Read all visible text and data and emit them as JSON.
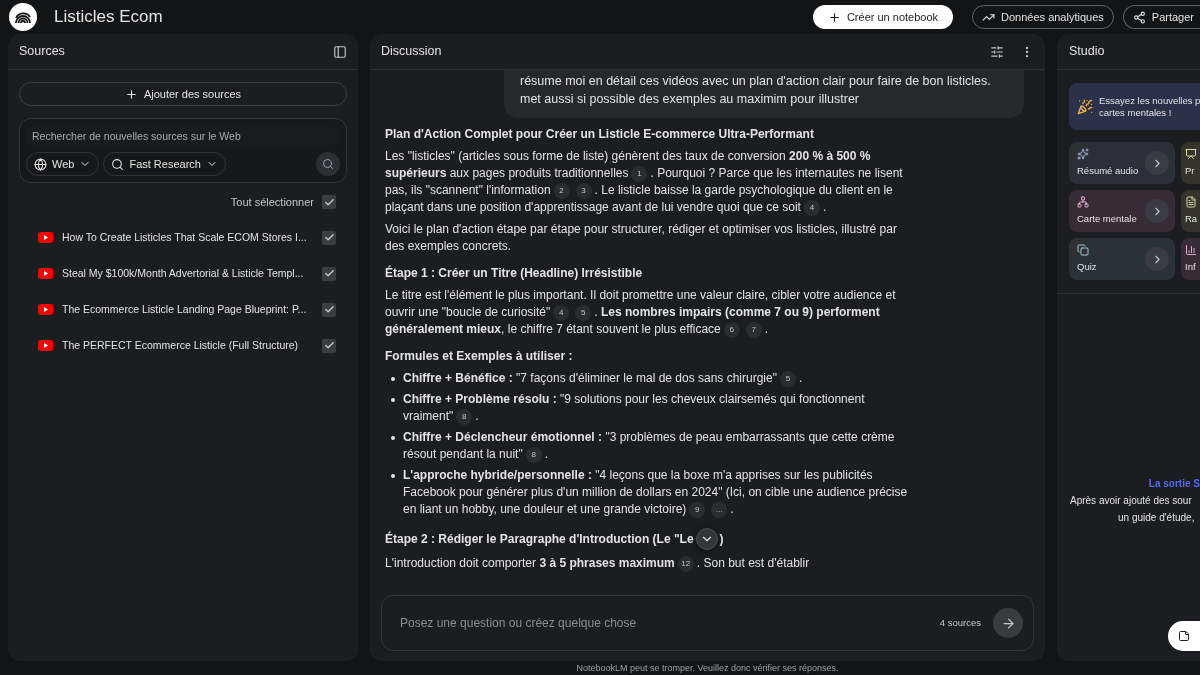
{
  "header": {
    "title": "Listicles Ecom",
    "buttons": [
      {
        "label": "Créer un notebook",
        "kind": "primary"
      },
      {
        "label": "Données analytiques",
        "kind": "analytics"
      },
      {
        "label": "Partager",
        "kind": "share"
      }
    ]
  },
  "sources": {
    "title": "Sources",
    "add_button": "Ajouter des sources",
    "search": {
      "placeholder": "Rechercher de nouvelles sources sur le Web",
      "source_type": "Web",
      "mode": "Fast Research"
    },
    "select_all": {
      "label": "Tout sélectionner",
      "checked": true
    },
    "items": [
      {
        "title": "How To Create Listicles That Scale ECOM Stores I...",
        "checked": true
      },
      {
        "title": "Steal My $100k/Month Advertorial & Listicle Templ...",
        "checked": true
      },
      {
        "title": "The Ecommerce Listicle Landing Page Blueprint: P...",
        "checked": true
      },
      {
        "title": "The PERFECT Ecommerce Listicle (Full Structure)",
        "checked": true
      }
    ]
  },
  "discussion": {
    "title": "Discussion",
    "user_message": "résume moi en détail ces vidéos avec un plan d'action clair pour faire de bon listicles. met aussi si possible des exemples au maximim pour illustrer",
    "blocks": [
      {
        "kind": "heading",
        "segs": [
          {
            "t": "Plan d'Action Complet pour Créer un Listicle E-commerce Ultra-Performant"
          }
        ]
      },
      {
        "kind": "paragraph",
        "segs": [
          {
            "t": "Les \"listicles\" (articles sous forme de liste) génèrent des taux de conversion **200 % à 500 % supérieurs** aux pages produits traditionnelles"
          },
          {
            "c": "1"
          },
          {
            "t": ". Pourquoi ? Parce que les internautes ne lisent pas, ils \"scannent\" l'information"
          },
          {
            "c": "2"
          },
          {
            "c": "3"
          },
          {
            "t": ". Le listicle baisse la garde psychologique du client en le plaçant dans une position d'apprentissage avant de lui vendre quoi que ce soit"
          },
          {
            "c": "4"
          },
          {
            "t": "."
          }
        ]
      },
      {
        "kind": "paragraph",
        "segs": [
          {
            "t": "Voici le plan d'action étape par étape pour structurer, rédiger et optimiser vos listicles, illustré par des exemples concrets."
          }
        ]
      },
      {
        "kind": "heading",
        "segs": [
          {
            "t": "Étape 1 : Créer un Titre (Headline) Irrésistible"
          }
        ]
      },
      {
        "kind": "paragraph",
        "segs": [
          {
            "t": "Le titre est l'élément le plus important. Il doit promettre une valeur claire, cibler votre audience et ouvrir une \"boucle de curiosité\""
          },
          {
            "c": "4"
          },
          {
            "c": "5"
          },
          {
            "t": ". **Les nombres impairs (comme 7 ou 9) performent généralement mieux**, le chiffre 7 étant souvent le plus efficace"
          },
          {
            "c": "6"
          },
          {
            "c": "7"
          },
          {
            "t": "."
          }
        ]
      },
      {
        "kind": "heading",
        "segs": [
          {
            "t": "Formules et Exemples à utiliser :"
          }
        ]
      },
      {
        "kind": "bullets",
        "items": [
          {
            "segs": [
              {
                "t": "**Chiffre + Bénéfice :** \"7 façons d'éliminer le mal de dos sans chirurgie\""
              },
              {
                "c": "5"
              },
              {
                "t": "."
              }
            ]
          },
          {
            "segs": [
              {
                "t": "**Chiffre + Problème résolu :** \"9 solutions pour les cheveux clairsemés qui fonctionnent vraiment\""
              },
              {
                "c": "8"
              },
              {
                "t": "."
              }
            ]
          },
          {
            "segs": [
              {
                "t": "**Chiffre + Déclencheur émotionnel :** \"3 problèmes de peau embarrassants que cette crème résout pendant la nuit\""
              },
              {
                "c": "8"
              },
              {
                "t": "."
              }
            ]
          },
          {
            "segs": [
              {
                "t": "**L'approche hybride/personnelle :** \"4 leçons que la boxe m'a apprises sur les publicités Facebook pour générer plus d'un million de dollars en 2024\" (Ici, on cible une audience précise en liant un hobby, une douleur et une grande victoire)"
              },
              {
                "c": "9"
              },
              {
                "c": "..."
              },
              {
                "t": "."
              }
            ]
          }
        ]
      },
      {
        "kind": "heading",
        "segs": [
          {
            "t": "Étape 2 : Rédiger le Paragraphe d'Introduction (Le \"Le"
          },
          {
            "kind": "scroll_button"
          },
          {
            "t": ")"
          }
        ]
      },
      {
        "kind": "paragraph",
        "segs": [
          {
            "t": "L'introduction doit comporter **3 à 5 phrases maximum**"
          },
          {
            "c": "12"
          },
          {
            "t": ". Son but est d'établir"
          }
        ]
      }
    ],
    "input": {
      "placeholder": "Posez une question ou créez quelque chose",
      "source_count": "4 sources"
    },
    "footer": "NotebookLM peut se tromper. Veuillez donc vérifier ses réponses."
  },
  "studio": {
    "title": "Studio",
    "banner": [
      "Essayez les nouvelles p",
      "cartes mentales !"
    ],
    "tiles": [
      {
        "label": "Résumé audio",
        "kind": "audio",
        "color": "#2c2f36"
      },
      {
        "label": "Pr",
        "kind": "video",
        "color": "#34342a"
      },
      {
        "label": "Carte mentale",
        "kind": "mindmap",
        "color": "#372b34"
      },
      {
        "label": "Ra",
        "kind": "report",
        "color": "#34342a"
      },
      {
        "label": "Quiz",
        "kind": "quiz",
        "color": "#2b3134"
      },
      {
        "label": "Inf",
        "kind": "infographic",
        "color": "#372b34"
      }
    ],
    "empty_title": "La sortie S",
    "empty_text": [
      "Après avoir ajouté des sour",
      "un guide d'étude,"
    ]
  }
}
